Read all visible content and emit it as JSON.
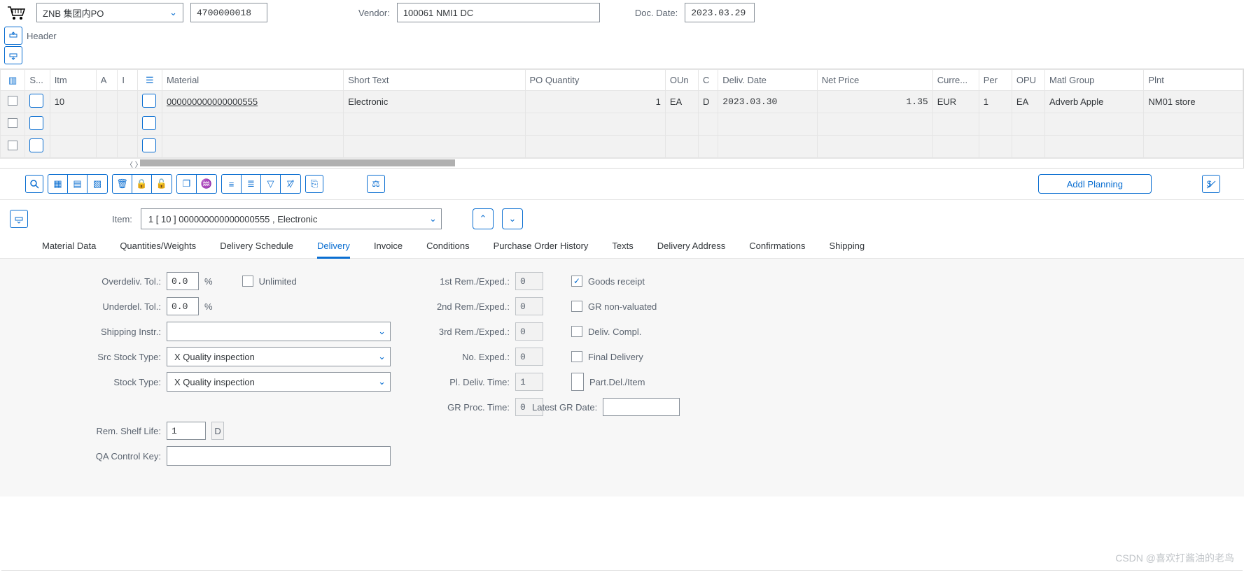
{
  "header": {
    "doc_type": "ZNB 集团内PO",
    "po_number": "4700000018",
    "vendor_label": "Vendor:",
    "vendor_value": "100061 NMI1 DC",
    "doc_date_label": "Doc. Date:",
    "doc_date_value": "2023.03.29",
    "header_label": "Header"
  },
  "grid": {
    "cols": {
      "s": "S...",
      "itm": "Itm",
      "a": "A",
      "i": "I",
      "material": "Material",
      "short_text": "Short Text",
      "po_qty": "PO Quantity",
      "oun": "OUn",
      "c": "C",
      "deliv_date": "Deliv. Date",
      "net_price": "Net Price",
      "curr": "Curre...",
      "per": "Per",
      "opu": "OPU",
      "matl_group": "Matl Group",
      "plnt": "Plnt"
    },
    "rows": [
      {
        "itm": "10",
        "material": "000000000000000555",
        "short_text": "Electronic",
        "po_qty": "1",
        "oun": "EA",
        "c": "D",
        "deliv_date": "2023.03.30",
        "net_price": "1.35",
        "curr": "EUR",
        "per": "1",
        "opu": "EA",
        "matl_group": "Adverb Apple",
        "plnt": "NM01 store"
      }
    ]
  },
  "toolbar": {
    "addl_planning": "Addl Planning"
  },
  "item_detail": {
    "item_label": "Item:",
    "item_value": "1 [ 10 ] 000000000000000555 , Electronic"
  },
  "tabs": [
    "Material Data",
    "Quantities/Weights",
    "Delivery Schedule",
    "Delivery",
    "Invoice",
    "Conditions",
    "Purchase Order History",
    "Texts",
    "Delivery Address",
    "Confirmations",
    "Shipping"
  ],
  "active_tab": "Delivery",
  "delivery": {
    "overdeliv_label": "Overdeliv. Tol.:",
    "overdeliv_val": "0.0",
    "percent": "%",
    "unlimited_label": "Unlimited",
    "underdel_label": "Underdel. Tol.:",
    "underdel_val": "0.0",
    "shipping_instr_label": "Shipping Instr.:",
    "src_stock_label": "Src Stock Type:",
    "src_stock_val": "X Quality inspection",
    "stock_label": "Stock Type:",
    "stock_val": "X Quality inspection",
    "rem_shelf_label": "Rem. Shelf Life:",
    "rem_shelf_val": "1",
    "rem_shelf_unit": "D",
    "qa_label": "QA Control Key:",
    "rem1_label": "1st Rem./Exped.:",
    "rem1_val": "0",
    "rem2_label": "2nd Rem./Exped.:",
    "rem2_val": "0",
    "rem3_label": "3rd Rem./Exped.:",
    "rem3_val": "0",
    "noexp_label": "No. Exped.:",
    "noexp_val": "0",
    "pldel_label": "Pl. Deliv. Time:",
    "pldel_val": "1",
    "grproc_label": "GR Proc. Time:",
    "grproc_val": "0",
    "goods_receipt": "Goods receipt",
    "gr_nonval": "GR non-valuated",
    "deliv_compl": "Deliv. Compl.",
    "final_deliv": "Final Delivery",
    "part_del": "Part.Del./Item",
    "latest_gr": "Latest GR Date:"
  },
  "watermark": "CSDN @喜欢打酱油的老鸟"
}
